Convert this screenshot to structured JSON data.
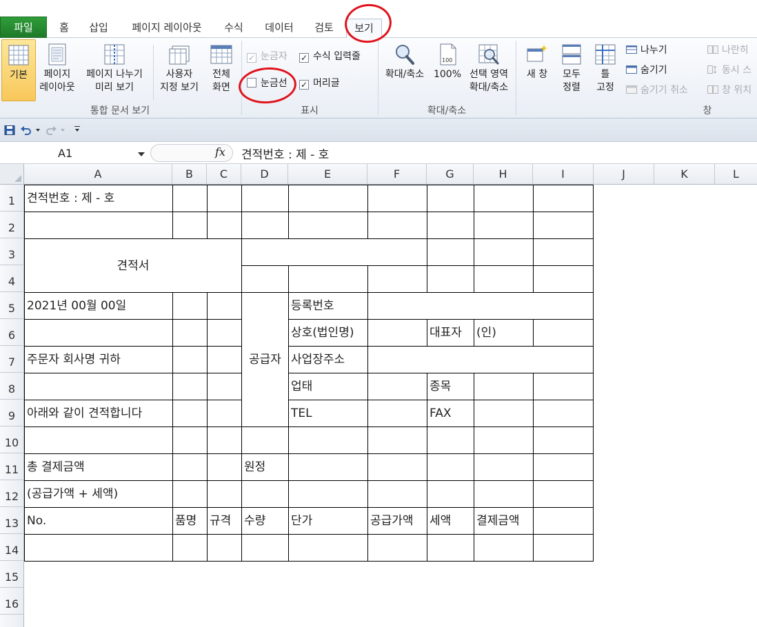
{
  "tabs": [
    "파일",
    "홈",
    "삽입",
    "페이지 레이아웃",
    "수식",
    "데이터",
    "검토",
    "보기"
  ],
  "active_tab": "보기",
  "ribbon": {
    "workbook_views": {
      "label": "통합 문서 보기",
      "normal": "기본",
      "page_layout": "페이지\n레이아웃",
      "page_break_preview": "페이지 나누기\n미리 보기",
      "custom_views": "사용자\n지정 보기",
      "full_screen": "전체\n화면"
    },
    "show": {
      "label": "표시",
      "ruler": "눈금자",
      "formula_bar": "수식 입력줄",
      "gridlines": "눈금선",
      "headings": "머리글",
      "ruler_checked": true,
      "formula_bar_checked": true,
      "gridlines_checked": false,
      "headings_checked": true
    },
    "zoom": {
      "label": "확대/축소",
      "zoom": "확대/축소",
      "zoom_100": "100%",
      "zoom_selection": "선택 영역\n확대/축소"
    },
    "window": {
      "label": "창",
      "new_window": "새 창",
      "arrange_all": "모두\n정렬",
      "freeze_panes": "틀\n고정",
      "split": "나누기",
      "hide": "숨기기",
      "unhide": "숨기기 취소",
      "side_by_side": "나란히",
      "sync_scroll": "동시 스",
      "reset_position": "창 위치"
    }
  },
  "formula_bar": {
    "name_box": "A1",
    "fx": "fx",
    "formula": "견적번호 : 제  -  호"
  },
  "columns": [
    "A",
    "B",
    "C",
    "D",
    "E",
    "F",
    "G",
    "H",
    "I",
    "J",
    "K",
    "L"
  ],
  "rows": [
    "1",
    "2",
    "3",
    "4",
    "5",
    "6",
    "7",
    "8",
    "9",
    "10",
    "11",
    "12",
    "13",
    "14",
    "15",
    "16"
  ],
  "cells": {
    "a1": "견적번호 : 제  -  호",
    "title": "견적서",
    "date": "2021년    00월    00일",
    "orderer": "주문자 회사명    귀하",
    "estimate_text": "아래와 같이 견적합니다",
    "supplier": "공급자",
    "reg_no": "등록번호",
    "company": "상호(법인명)",
    "ceo": "대표자",
    "seal": "(인)",
    "address": "사업장주소",
    "business_type": "업태",
    "business_item": "종목",
    "tel": "TEL",
    "fax": "FAX",
    "total": "총 결제금액",
    "won": "원정",
    "supply_plus_tax": "(공급가액 + 세액)",
    "no": "No.",
    "item_name": "품명",
    "spec": "규격",
    "quantity": "수량",
    "unit_price": "단가",
    "supply_amount": "공급가액",
    "tax": "세액",
    "payment_amount": "결제금액"
  }
}
